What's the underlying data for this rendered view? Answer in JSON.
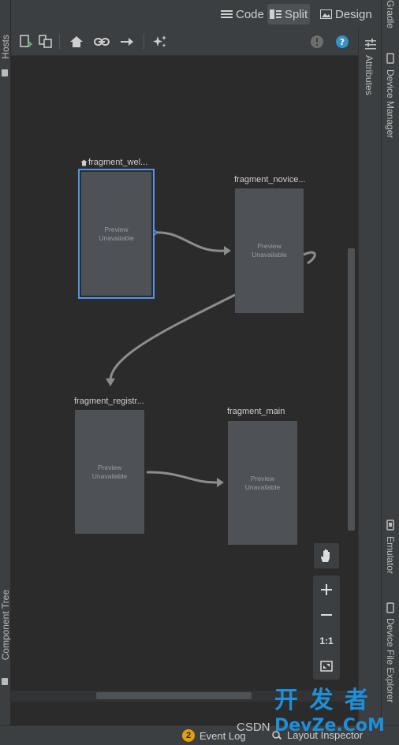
{
  "mode_bar": {
    "code": "Code",
    "split": "Split",
    "design": "Design",
    "active": "Split"
  },
  "side_tabs": {
    "left_top": "Hosts",
    "left_bottom": "Component Tree",
    "attributes": "Attributes",
    "right": [
      "Gradle",
      "Device Manager",
      "Emulator",
      "Device File Explorer"
    ]
  },
  "toolbar": {
    "icons": [
      "new-destination-icon",
      "nest-graph-icon",
      "start-destination-icon",
      "deep-link-icon",
      "action-arrow-icon",
      "auto-arrange-icon",
      "warning-icon",
      "help-icon"
    ]
  },
  "graph": {
    "nodes": [
      {
        "id": "welcome",
        "label": "fragment_wel...",
        "preview": [
          "Preview",
          "Unavailable"
        ],
        "start": true,
        "selected": true
      },
      {
        "id": "novice",
        "label": "fragment_novice...",
        "preview": [
          "Preview",
          "Unavailable"
        ]
      },
      {
        "id": "registr",
        "label": "fragment_registr...",
        "preview": [
          "Preview",
          "Unavailable"
        ]
      },
      {
        "id": "main",
        "label": "fragment_main",
        "preview": [
          "Preview",
          "Unavailable"
        ]
      }
    ]
  },
  "zoom": {
    "one_to_one": "1:1"
  },
  "status": {
    "event_log_count": "2",
    "event_log": "Event Log",
    "layout_inspector": "Layout Inspector"
  },
  "watermark": {
    "brand": "开 发 者",
    "site": "DevZe.CoM",
    "csdn": "CSDN"
  },
  "colors": {
    "selection": "#5394ec",
    "node": "#4e5256",
    "edge": "#8a8d90",
    "badge": "#e3a008",
    "help": "#3592c4"
  }
}
